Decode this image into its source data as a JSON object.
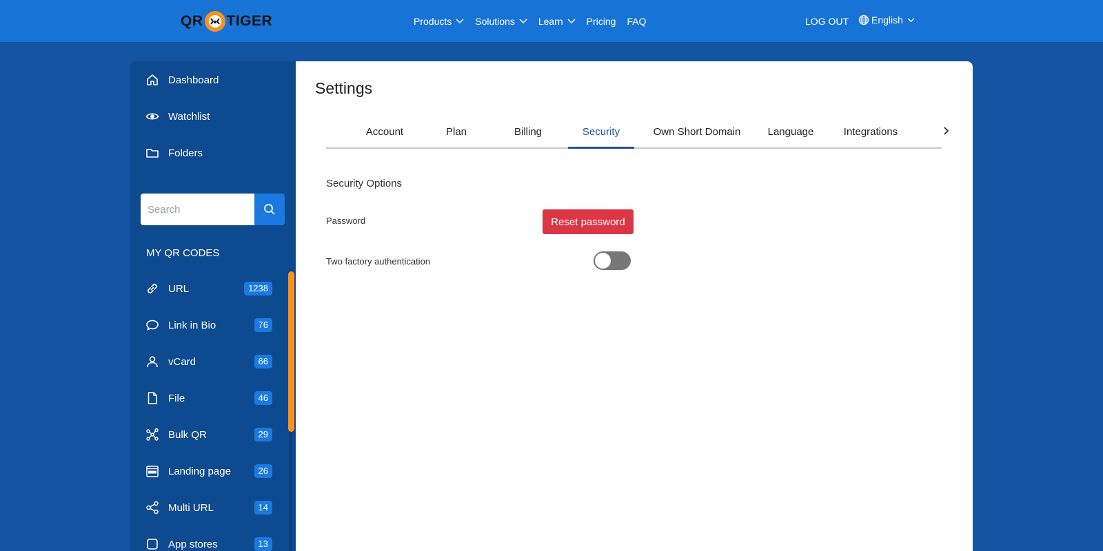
{
  "header": {
    "logo_left": "QR",
    "logo_right": "TIGER",
    "nav": [
      {
        "label": "Products",
        "has_dropdown": true
      },
      {
        "label": "Solutions",
        "has_dropdown": true
      },
      {
        "label": "Learn",
        "has_dropdown": true
      },
      {
        "label": "Pricing",
        "has_dropdown": false
      },
      {
        "label": "FAQ",
        "has_dropdown": false
      }
    ],
    "logout": "LOG OUT",
    "language": "English"
  },
  "sidebar": {
    "links": [
      {
        "label": "Dashboard",
        "icon": "home-icon"
      },
      {
        "label": "Watchlist",
        "icon": "eye-icon"
      },
      {
        "label": "Folders",
        "icon": "folder-icon"
      }
    ],
    "search_placeholder": "Search",
    "section_title": "MY QR CODES",
    "qr_types": [
      {
        "label": "URL",
        "count": "1238",
        "icon": "link-icon"
      },
      {
        "label": "Link in Bio",
        "count": "76",
        "icon": "chat-bubble-icon"
      },
      {
        "label": "vCard",
        "count": "66",
        "icon": "person-icon"
      },
      {
        "label": "File",
        "count": "46",
        "icon": "file-icon"
      },
      {
        "label": "Bulk QR",
        "count": "29",
        "icon": "network-icon"
      },
      {
        "label": "Landing page",
        "count": "26",
        "icon": "html-file-icon"
      },
      {
        "label": "Multi URL",
        "count": "14",
        "icon": "share-icon"
      },
      {
        "label": "App stores",
        "count": "13",
        "icon": "app-icon"
      }
    ]
  },
  "main": {
    "title": "Settings",
    "tabs": [
      {
        "label": "Account",
        "active": false
      },
      {
        "label": "Plan",
        "active": false
      },
      {
        "label": "Billing",
        "active": false
      },
      {
        "label": "Security",
        "active": true
      },
      {
        "label": "Own Short Domain",
        "active": false
      },
      {
        "label": "Language",
        "active": false
      },
      {
        "label": "Integrations",
        "active": false
      }
    ],
    "section_heading": "Security Options",
    "password_label": "Password",
    "reset_button": "Reset password",
    "two_factor_label": "Two factory authentication",
    "two_factor_enabled": false
  },
  "colors": {
    "header_bg": "#1873d6",
    "page_bg": "#1355a3",
    "sidebar_bg": "#0e4a8f",
    "accent": "#1a7ae0",
    "active_tab": "#1c55a3",
    "danger": "#dc3545",
    "scroll_thumb": "#f7931e",
    "logo_orange": "#f7931e"
  }
}
